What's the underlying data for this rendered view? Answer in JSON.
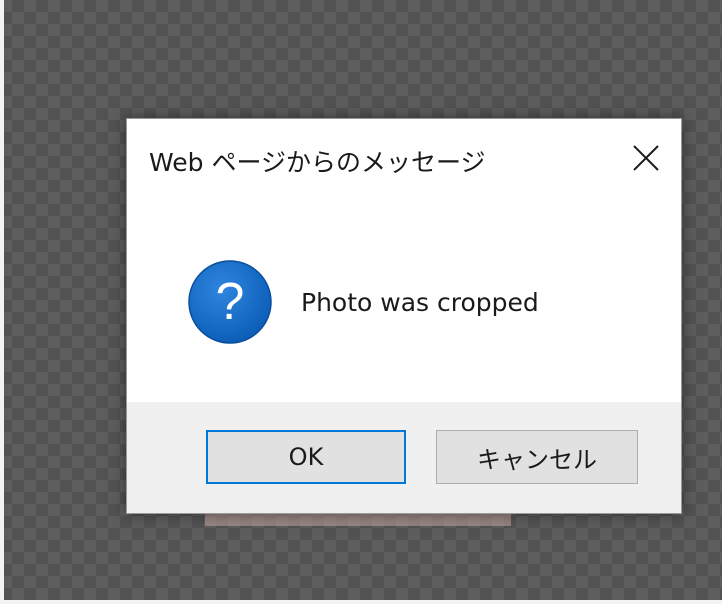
{
  "dialog": {
    "title": "Web ページからのメッセージ",
    "close_icon": "close-icon",
    "message_icon": "question-icon",
    "message": "Photo was cropped",
    "ok_label": "OK",
    "cancel_label": "キャンセル"
  },
  "colors": {
    "icon_blue": "#0a64c0",
    "focus_border": "#0078d7",
    "footer_bg": "#f0f0f0"
  }
}
